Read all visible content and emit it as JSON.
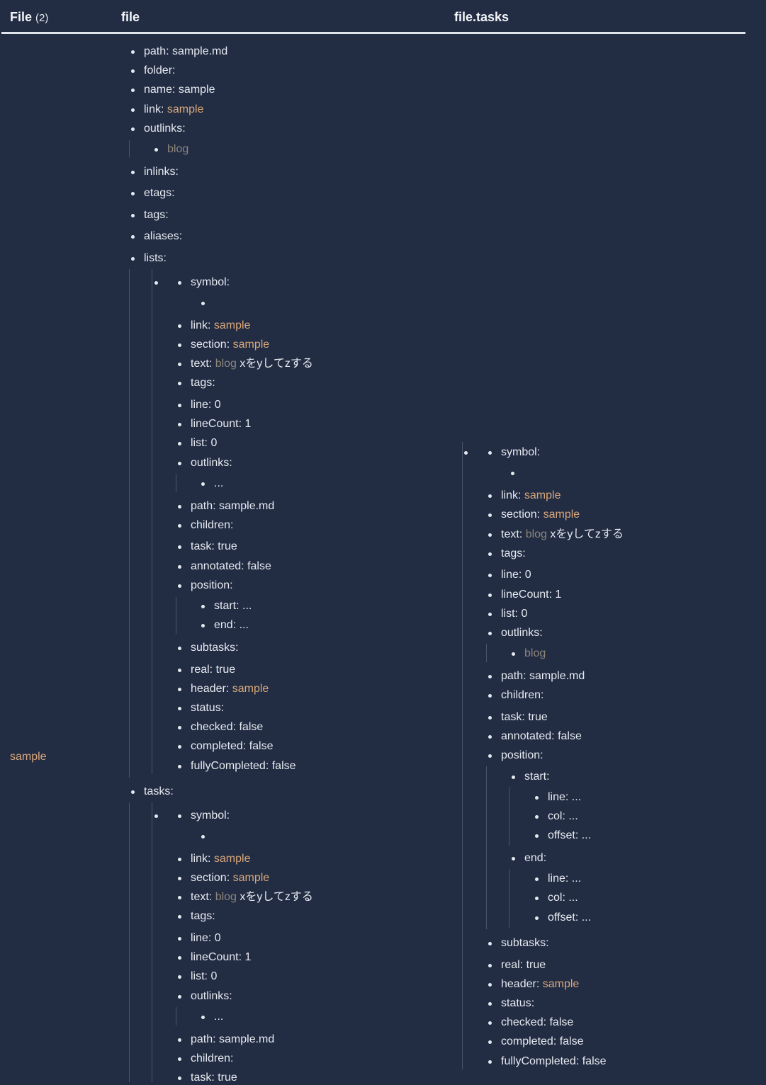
{
  "header": {
    "file_col": "File",
    "file_count": "(2)",
    "file_field": "file",
    "tasks_field": "file.tasks"
  },
  "row": {
    "file_link": "sample"
  },
  "file_fields": {
    "path": "path: sample.md",
    "folder": "folder:",
    "name": "name: sample",
    "link_label": "link:",
    "link_value": "sample",
    "outlinks": "outlinks:",
    "outlink_item": "blog",
    "inlinks": "inlinks:",
    "etags": "etags:",
    "tags": "tags:",
    "aliases": "aliases:",
    "lists": "lists:",
    "tasks": "tasks:"
  },
  "item": {
    "symbol": "symbol:",
    "link_label": "link:",
    "link_value": "sample",
    "section_label": "section:",
    "section_value": "sample",
    "text_label": "text:",
    "text_tag": "blog",
    "text_rest": "xをyしてzする",
    "tags": "tags:",
    "line": "line: 0",
    "lineCount": "lineCount: 1",
    "list": "list: 0",
    "outlinks": "outlinks:",
    "ellipsis": "...",
    "outlink_item": "blog",
    "path": "path: sample.md",
    "children": "children:",
    "task": "task: true",
    "annotated": "annotated: false",
    "position": "position:",
    "start_short": "start: ...",
    "end_short": "end: ...",
    "start": "start:",
    "end": "end:",
    "pos_line": "line: ...",
    "pos_col": "col: ...",
    "pos_offset": "offset: ...",
    "subtasks": "subtasks:",
    "real": "real: true",
    "header_label": "header:",
    "header_value": "sample",
    "status": "status:",
    "checked": "checked: false",
    "completed": "completed: false",
    "fullyCompleted": "fullyCompleted: false"
  },
  "colors": {
    "background": "#222d44",
    "text": "#e6e9ef",
    "link": "#d9a77a",
    "tag": "#8d867b",
    "guide": "#4a556d"
  }
}
